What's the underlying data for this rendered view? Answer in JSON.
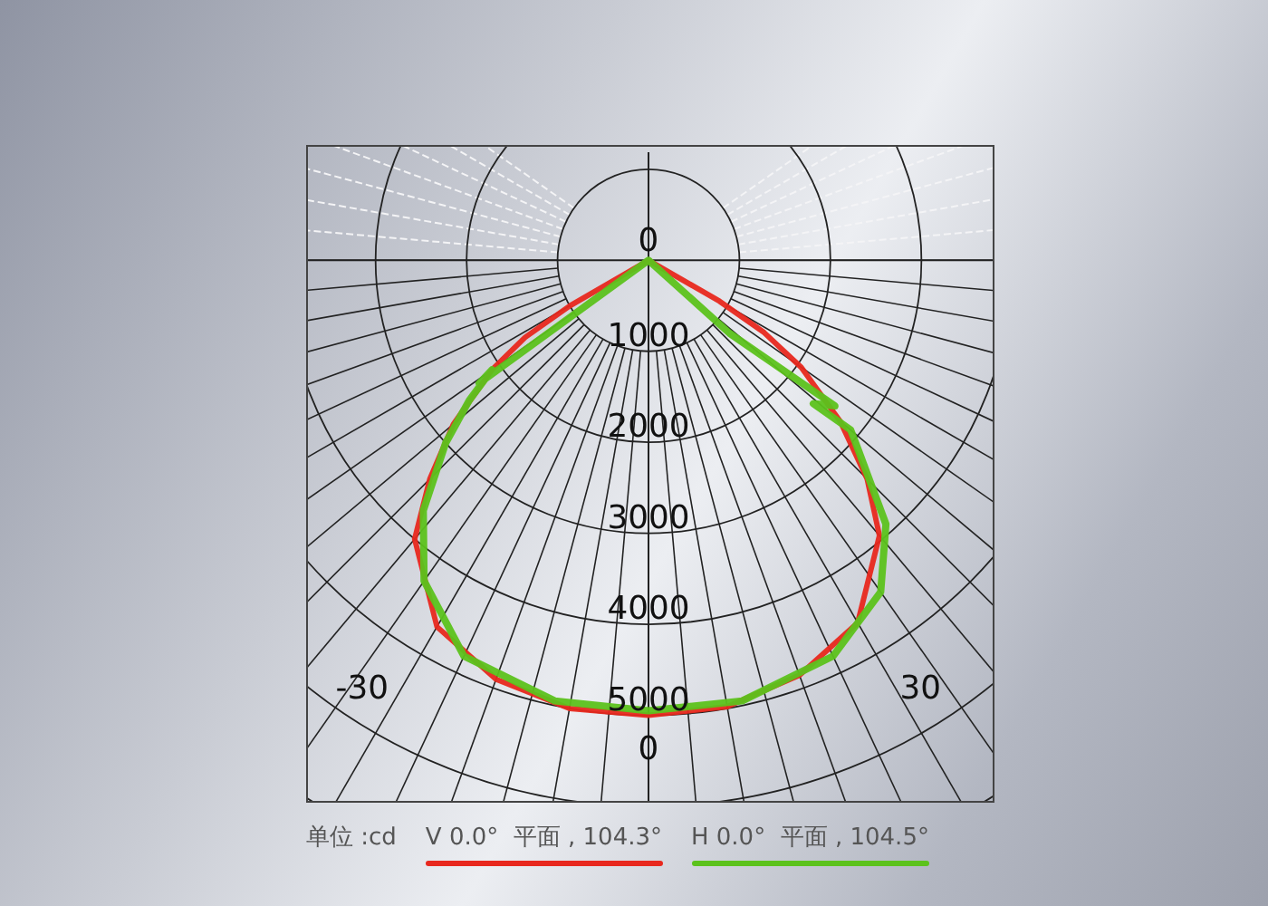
{
  "chart": {
    "center_label": "0",
    "ring_labels": [
      "1000",
      "2000",
      "3000",
      "4000",
      "5000"
    ],
    "angle_labels": [
      "-30",
      "30"
    ],
    "bottom_label": "0"
  },
  "legend": {
    "unit": "单位 :cd",
    "series": [
      {
        "label": "V 0.0°  平面 , 104.3°",
        "color": "#e8281e"
      },
      {
        "label": "H 0.0°  平面 , 104.5°",
        "color": "#5cc21c"
      }
    ]
  }
}
